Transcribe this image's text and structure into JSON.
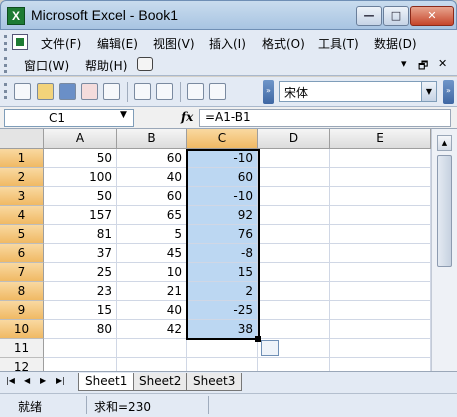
{
  "window": {
    "title": "Microsoft Excel - Book1",
    "min_glyph": "—",
    "max_glyph": "□",
    "close_glyph": "✕"
  },
  "menu": {
    "items": [
      "文件(F)",
      "编辑(E)",
      "视图(V)",
      "插入(I)",
      "格式(O)",
      "工具(T)",
      "数据(D)",
      "窗口(W)",
      "帮助(H)"
    ],
    "doc_controls": [
      "▾",
      "🗗",
      "✕"
    ]
  },
  "toolbar": {
    "font_name": "宋体",
    "dropdown_glyph": "▼",
    "more_glyph": "»"
  },
  "formula_bar": {
    "name_box": "C1",
    "name_drop_glyph": "▼",
    "fx_label": "fx",
    "formula": "=A1-B1"
  },
  "grid": {
    "columns": [
      "A",
      "B",
      "C",
      "D",
      "E"
    ],
    "rows": [
      "1",
      "2",
      "3",
      "4",
      "5",
      "6",
      "7",
      "8",
      "9",
      "10",
      "11",
      "12"
    ],
    "data": [
      [
        "50",
        "60",
        "-10"
      ],
      [
        "100",
        "40",
        "60"
      ],
      [
        "50",
        "60",
        "-10"
      ],
      [
        "157",
        "65",
        "92"
      ],
      [
        "81",
        "5",
        "76"
      ],
      [
        "37",
        "45",
        "-8"
      ],
      [
        "25",
        "10",
        "15"
      ],
      [
        "23",
        "21",
        "2"
      ],
      [
        "15",
        "40",
        "-25"
      ],
      [
        "80",
        "42",
        "38"
      ]
    ],
    "active_column": "C",
    "selection": "C1:C10"
  },
  "scrollbar": {
    "up_glyph": "▲",
    "down_glyph": "▼"
  },
  "sheets": {
    "tabs": [
      "Sheet1",
      "Sheet2",
      "Sheet3"
    ],
    "active": "Sheet1",
    "nav": [
      "|◀",
      "◀",
      "▶",
      "▶|"
    ]
  },
  "status": {
    "ready": "就绪",
    "sum": "求和=230"
  },
  "colors": {
    "selection_fill": "#bcd7f2",
    "active_header": "#f0b964",
    "title_bar": "#a8c4e2"
  }
}
